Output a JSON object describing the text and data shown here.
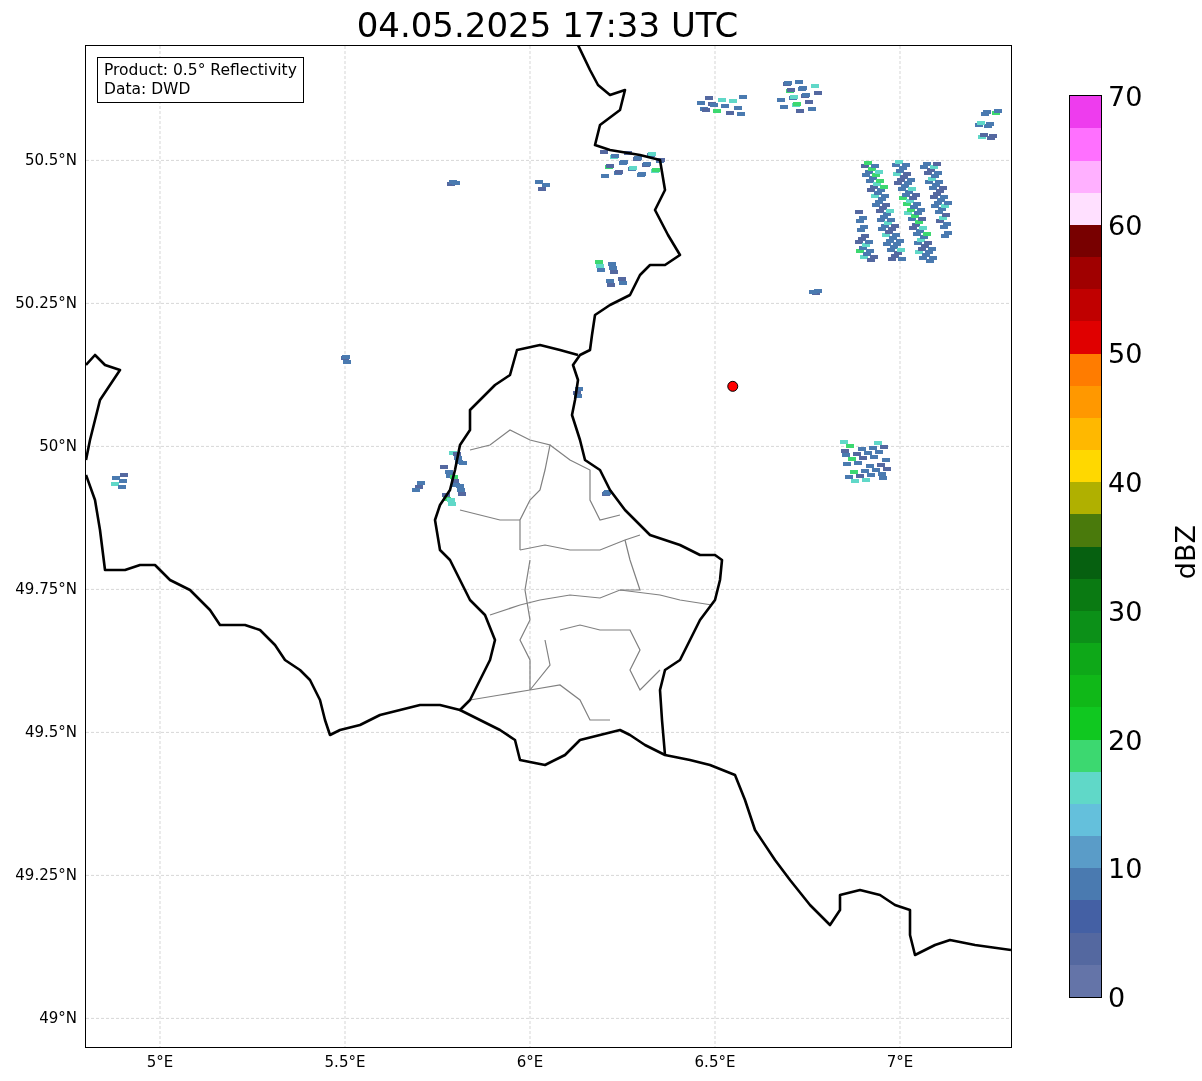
{
  "title": "04.05.2025 17:33 UTC",
  "info_box": [
    "Product: 0.5° Reflectivity",
    "Data: DWD"
  ],
  "map": {
    "lat_labels": [
      "50.5°N",
      "50.25°N",
      "50°N",
      "49.75°N",
      "49.5°N",
      "49.25°N",
      "49°N"
    ],
    "lon_labels": [
      "5°E",
      "5.5°E",
      "6°E",
      "6.5°E",
      "7°E"
    ]
  },
  "colorbar": {
    "label": "dBZ",
    "ticks": [
      "70",
      "60",
      "50",
      "40",
      "30",
      "20",
      "10",
      "0"
    ],
    "bins": [
      {
        "color": "#6474a8"
      },
      {
        "color": "#5468a0"
      },
      {
        "color": "#4460a4"
      },
      {
        "color": "#4a7ab0"
      },
      {
        "color": "#5a9cc8"
      },
      {
        "color": "#64c0dc"
      },
      {
        "color": "#60d8c8"
      },
      {
        "color": "#3cd870"
      },
      {
        "color": "#10c820"
      },
      {
        "color": "#10b818"
      },
      {
        "color": "#0ea818"
      },
      {
        "color": "#0c9018"
      },
      {
        "color": "#0a7a12"
      },
      {
        "color": "#066010"
      },
      {
        "color": "#4a7a0c"
      },
      {
        "color": "#b0b000"
      },
      {
        "color": "#ffd800"
      },
      {
        "color": "#ffb800"
      },
      {
        "color": "#ff9800"
      },
      {
        "color": "#ff7c00"
      },
      {
        "color": "#e00000"
      },
      {
        "color": "#c00000"
      },
      {
        "color": "#a00000"
      },
      {
        "color": "#780000"
      },
      {
        "color": "#ffe0ff"
      },
      {
        "color": "#ffb0ff"
      },
      {
        "color": "#ff70ff"
      },
      {
        "color": "#ee3cee"
      }
    ]
  }
}
